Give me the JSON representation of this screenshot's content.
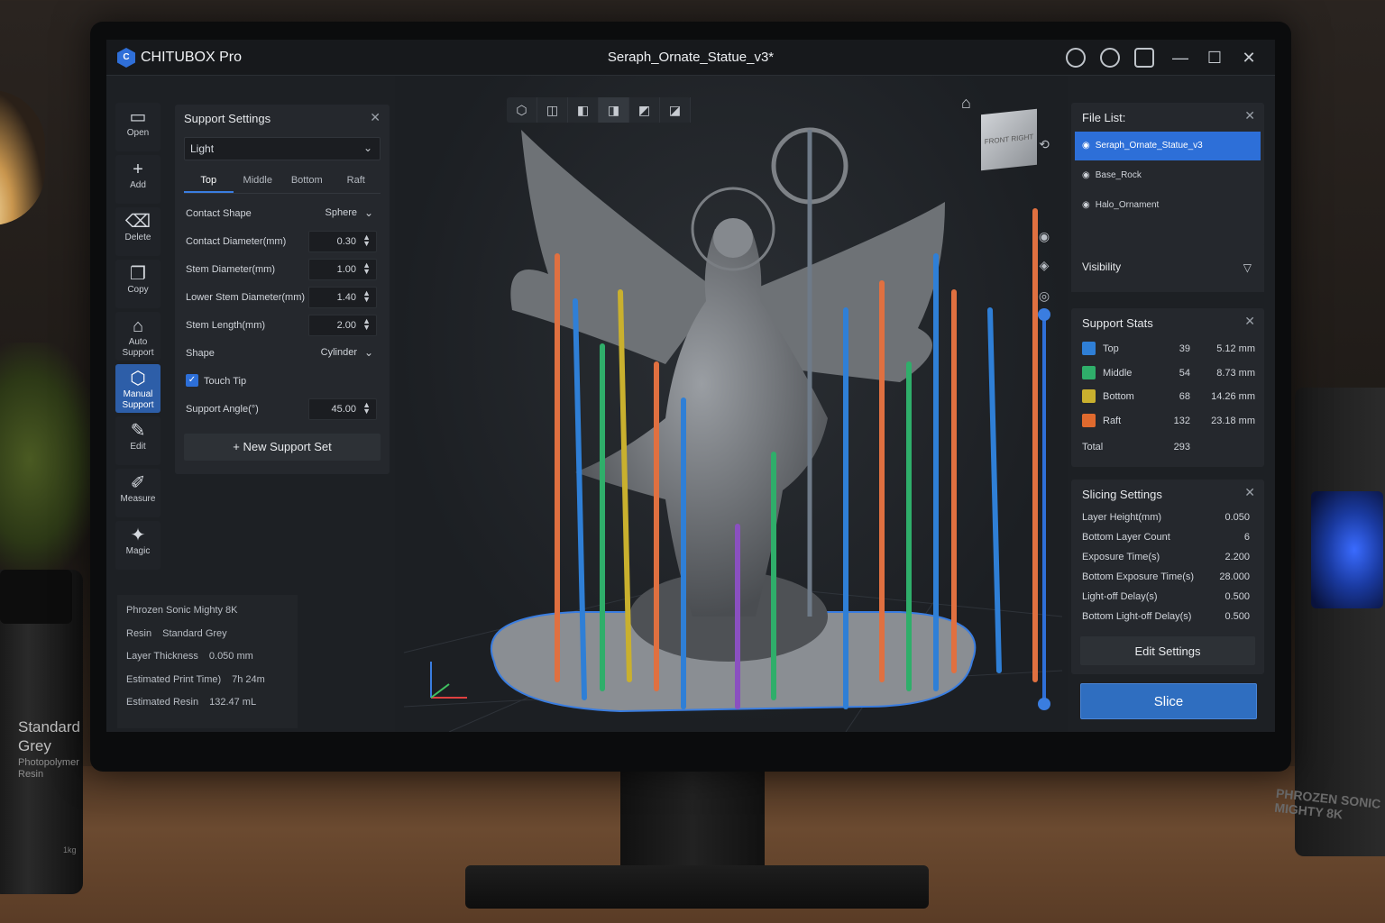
{
  "app": {
    "name": "CHITUBOX Pro",
    "logo_glyph": "C",
    "file_title": "Seraph_Ornate_Statue_v3*",
    "window_controls": [
      "minimize-icon",
      "maximize-icon",
      "close-icon"
    ]
  },
  "toolbar": {
    "items": [
      {
        "label": "Open",
        "icon": "folder-icon"
      },
      {
        "label": "Add",
        "icon": "plus-icon"
      },
      {
        "label": "Delete",
        "icon": "delete-icon"
      },
      {
        "label": "Copy",
        "icon": "copy-icon"
      },
      {
        "label": "Auto Support",
        "icon": "auto-support-icon"
      },
      {
        "label": "Manual Support",
        "icon": "manual-support-icon",
        "active": true
      },
      {
        "label": "Edit",
        "icon": "edit-icon"
      },
      {
        "label": "Measure",
        "icon": "measure-icon"
      },
      {
        "label": "Magic",
        "icon": "magic-icon"
      }
    ]
  },
  "support_settings": {
    "title": "Support Settings",
    "preset": "Light",
    "tabs": [
      "Top",
      "Middle",
      "Bottom",
      "Raft"
    ],
    "active_tab": "Top",
    "contact_shape_label": "Contact Shape",
    "contact_shape_value": "Sphere",
    "fields": [
      {
        "label": "Contact Diameter(mm)",
        "value": "0.30"
      },
      {
        "label": "Stem Diameter(mm)",
        "value": "1.00"
      },
      {
        "label": "Lower Stem Diameter(mm)",
        "value": "1.40"
      },
      {
        "label": "Stem Length(mm)",
        "value": "2.00"
      }
    ],
    "shape_label": "Shape",
    "shape_value": "Cylinder",
    "touch_tip_label": "Touch Tip",
    "touch_tip_checked": true,
    "support_angle_label": "Support Angle(°)",
    "support_angle_value": "45.00",
    "new_set_label": "New Support Set"
  },
  "printer_info": {
    "printer": "Phrozen Sonic Mighty 8K",
    "resin_label": "Resin",
    "resin_value": "Standard Grey",
    "layer_label": "Layer Thickness",
    "layer_value": "0.050 mm",
    "time_label": "Estimated Print Time)",
    "time_value": "7h 24m",
    "resin_est_label": "Estimated Resin",
    "resin_est_value": "132.47 mL"
  },
  "viewport": {
    "view_tools": [
      "cube-iso-icon",
      "cube-front-icon",
      "cube-left-icon",
      "cube-right-icon",
      "cube-top-icon",
      "cube-bottom-icon"
    ],
    "navcube_label": "FRONT  RIGHT"
  },
  "file_list": {
    "title": "File List:",
    "items": [
      {
        "name": "Seraph_Ornate_Statue_v3",
        "selected": true
      },
      {
        "name": "Base_Rock",
        "selected": false
      },
      {
        "name": "Halo_Ornament",
        "selected": false
      }
    ]
  },
  "visibility": {
    "label": "Visibility"
  },
  "support_stats": {
    "title": "Support Stats",
    "rows": [
      {
        "name": "Top",
        "count": "39",
        "length": "5.12 mm",
        "color": "#2f7fd6"
      },
      {
        "name": "Middle",
        "count": "54",
        "length": "8.73 mm",
        "color": "#2fae6a"
      },
      {
        "name": "Bottom",
        "count": "68",
        "length": "14.26 mm",
        "color": "#c9b02e"
      },
      {
        "name": "Raft",
        "count": "132",
        "length": "23.18 mm",
        "color": "#e06a2e"
      }
    ],
    "total_label": "Total",
    "total_value": "293"
  },
  "slicing_settings": {
    "title": "Slicing Settings",
    "rows": [
      {
        "label": "Layer Height(mm)",
        "value": "0.050"
      },
      {
        "label": "Bottom Layer Count",
        "value": "6"
      },
      {
        "label": "Exposure Time(s)",
        "value": "2.200"
      },
      {
        "label": "Bottom Exposure Time(s)",
        "value": "28.000"
      },
      {
        "label": "Light-off Delay(s)",
        "value": "0.500"
      },
      {
        "label": "Bottom Light-off Delay(s)",
        "value": "0.500"
      }
    ],
    "edit_label": "Edit Settings"
  },
  "slice_label": "Slice",
  "scene": {
    "bottle_title": "Standard Grey",
    "bottle_sub": "Photopolymer Resin",
    "bottle_weight": "1kg",
    "printer_brand": "PHROZEN SONIC MIGHTY 8K"
  }
}
